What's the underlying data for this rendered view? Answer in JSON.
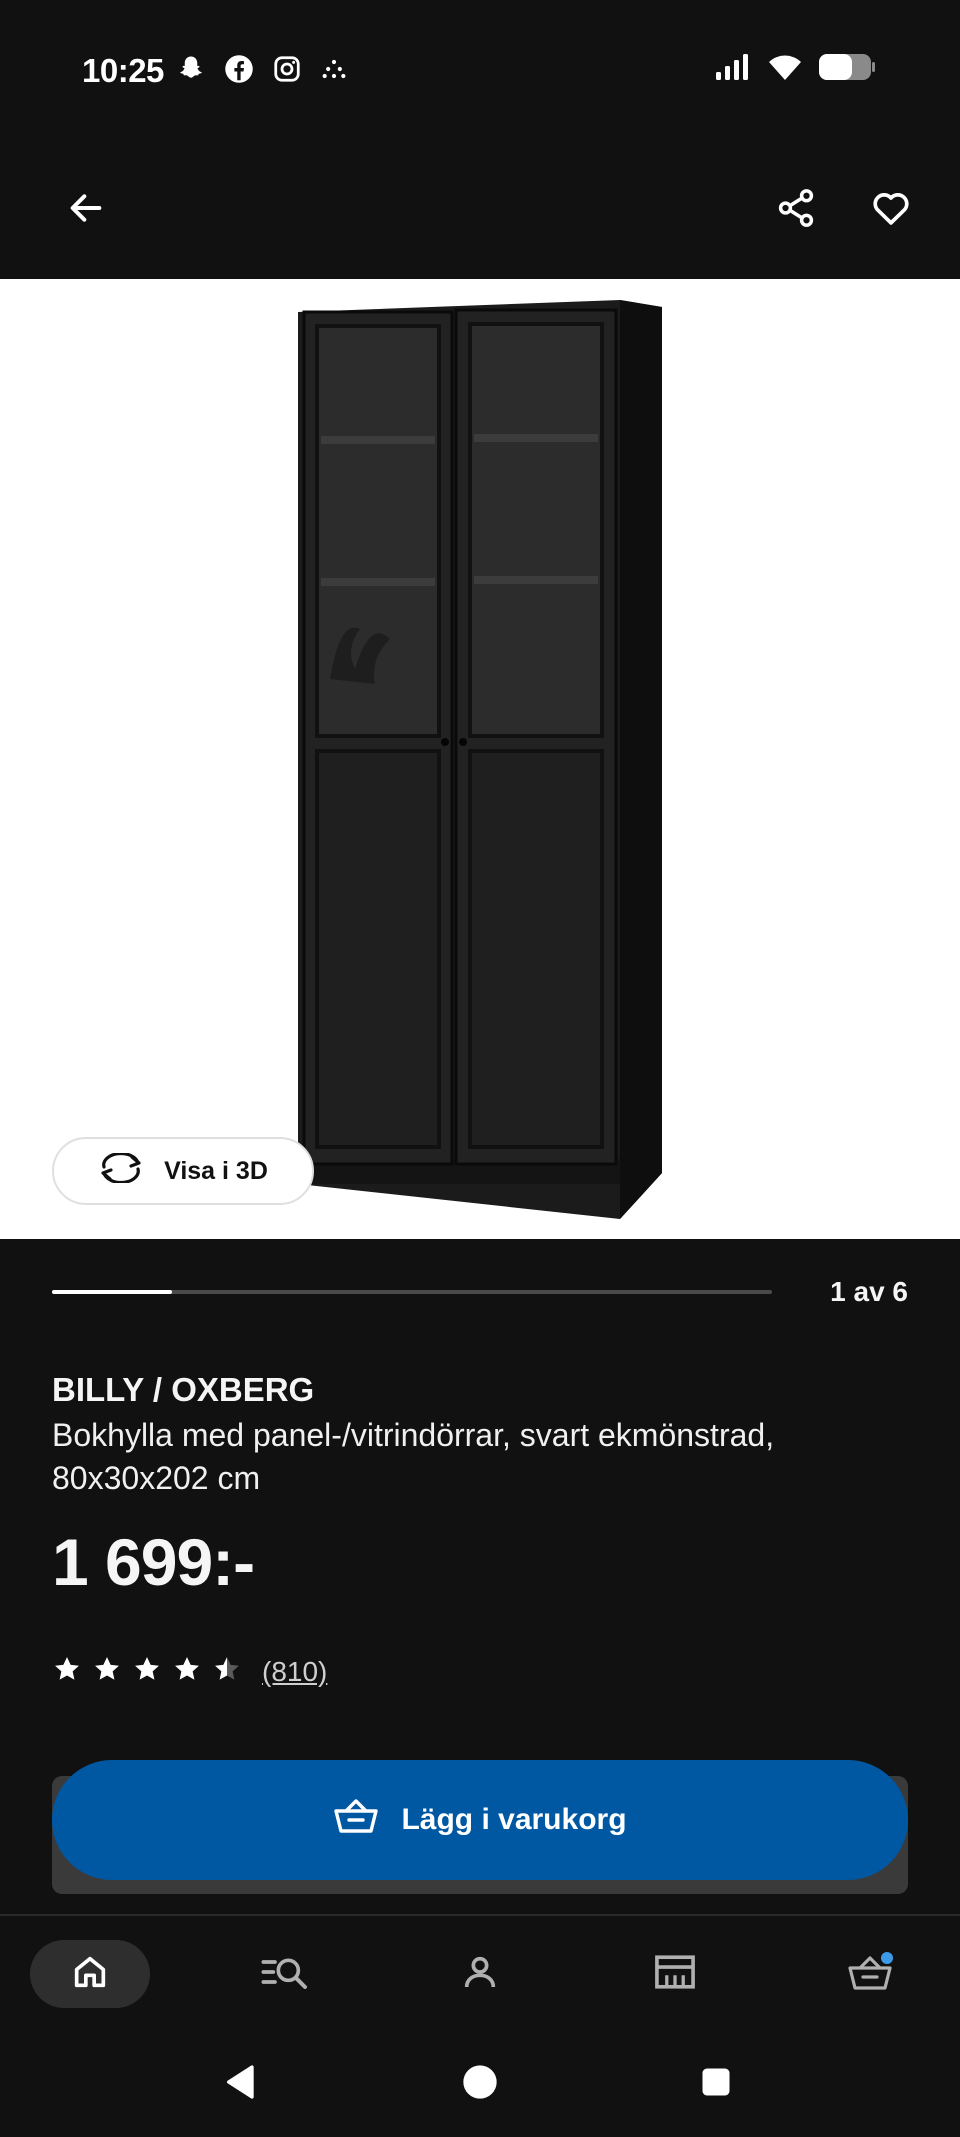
{
  "status_bar": {
    "time": "10:25",
    "left_icons": [
      "snapchat-icon",
      "facebook-icon",
      "instagram-icon",
      "dots-icon"
    ],
    "right_icons": [
      "signal-icon",
      "wifi-icon",
      "battery-icon"
    ]
  },
  "app_bar": {
    "back_icon": "arrow-left-icon",
    "share_icon": "share-icon",
    "favorite_icon": "heart-icon"
  },
  "gallery": {
    "view_3d_label": "Visa i 3D",
    "image_index": 1,
    "image_total": 6,
    "counter_text": "1 av 6",
    "progress": 0.1667
  },
  "product": {
    "name": "BILLY / OXBERG",
    "description": "Bokhylla med panel-/vitrindörrar, svart ekmönstrad, 80x30x202 cm",
    "price": "1 699:-",
    "rating": 4.5,
    "review_count": "(810)"
  },
  "cart": {
    "button_label": "Lägg i varukorg",
    "icon": "basket-icon"
  },
  "bottom_nav": {
    "items": [
      {
        "name": "home",
        "icon": "home-icon",
        "active": true
      },
      {
        "name": "search",
        "icon": "search-list-icon",
        "active": false
      },
      {
        "name": "profile",
        "icon": "person-icon",
        "active": false
      },
      {
        "name": "store",
        "icon": "store-icon",
        "active": false
      },
      {
        "name": "cart",
        "icon": "basket-icon",
        "active": false,
        "badge": true
      }
    ]
  },
  "colors": {
    "background": "#111111",
    "accent_blue": "#0058a3",
    "badge_blue": "#3b9be8",
    "text": "#f5f5f5"
  }
}
